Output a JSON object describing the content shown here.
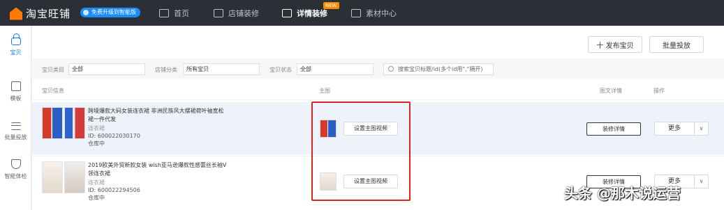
{
  "app": {
    "name": "淘宝旺铺",
    "upgrade_badge": "免费升级到智能版",
    "nav": [
      {
        "label": "首页",
        "icon": "home-icon"
      },
      {
        "label": "店铺装修",
        "icon": "store-icon"
      },
      {
        "label": "详情装修",
        "icon": "document-icon",
        "badge": "NEW"
      },
      {
        "label": "素材中心",
        "icon": "folder-icon"
      }
    ]
  },
  "sidebar": [
    {
      "label": "宝贝",
      "icon": "bag-icon",
      "active": true
    },
    {
      "label": "模板",
      "icon": "template-icon"
    },
    {
      "label": "批量投放",
      "icon": "batch-icon"
    },
    {
      "label": "智能体检",
      "icon": "shield-icon"
    }
  ],
  "toolbar": {
    "publish": "十 发布宝贝",
    "batch": "批量投放"
  },
  "filters": {
    "category_label": "宝贝类目",
    "category_value": "全部",
    "shop_cat_label": "店铺分类",
    "shop_cat_value": "所有宝贝",
    "status_label": "宝贝状态",
    "status_value": "全部",
    "search_placeholder": "搜索宝贝标题/id(多个id用\",\"隔开)"
  },
  "table": {
    "headers": {
      "info": "宝贝信息",
      "main_image": "主图",
      "detail": "图文详情",
      "action": "操作"
    },
    "rows": [
      {
        "title": "跨境爆款大码女装连衣裙 非洲民族风大摆裙荷叶袖宽松裙一件代发",
        "category": "连衣裙",
        "id": "ID: 600022030170",
        "status": "仓库中",
        "video_btn": "设置主图视频",
        "edit_btn": "装修详情",
        "more": "更多"
      },
      {
        "title": "2019欧美外贸新款女装 wish亚马逊爆款性感蕾丝长袖V领连衣裙",
        "category": "连衣裙",
        "id": "ID: 600022294506",
        "status": "仓库中",
        "video_btn": "设置主图视频",
        "edit_btn": "装修详情",
        "more": "更多"
      }
    ]
  },
  "watermark": "头条 @那木说运营",
  "colors": {
    "accent": "#1677ff",
    "highlight": "#d8261f",
    "topbar": "#2b2f36"
  }
}
